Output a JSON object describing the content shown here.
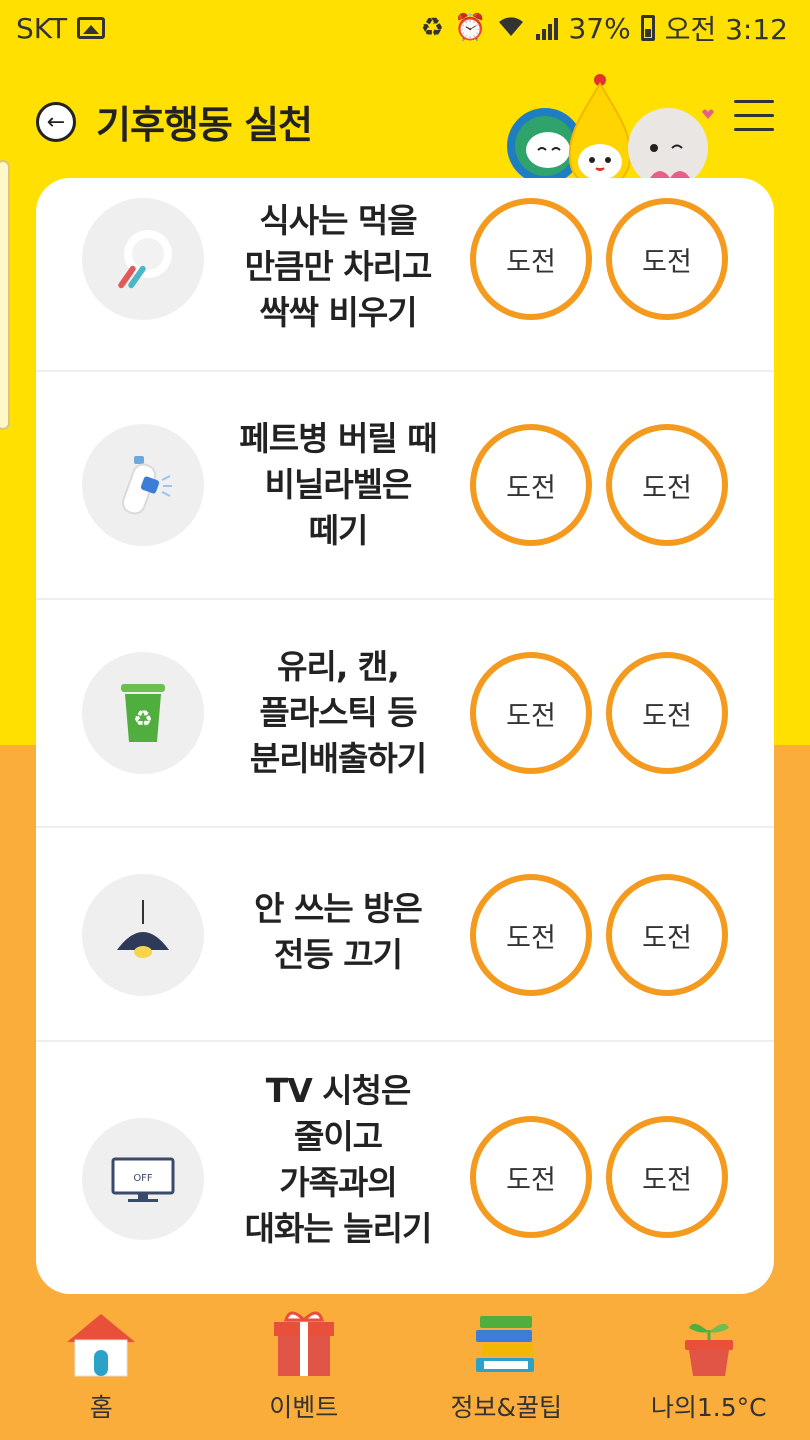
{
  "status_bar": {
    "carrier": "SKT",
    "battery": "37%",
    "time": "오전 3:12"
  },
  "header": {
    "title": "기후행동 실천"
  },
  "actions": [
    {
      "text": "식사는 먹을\n만큼만 차리고\n싹싹 비우기",
      "icon": "plate-icon",
      "btn1": "도전",
      "btn2": "도전"
    },
    {
      "text": "페트병 버릴 때\n비닐라벨은\n떼기",
      "icon": "pet-bottle-icon",
      "btn1": "도전",
      "btn2": "도전"
    },
    {
      "text": "유리, 캔,\n플라스틱 등\n분리배출하기",
      "icon": "recycle-bin-icon",
      "btn1": "도전",
      "btn2": "도전"
    },
    {
      "text": "안 쓰는 방은\n전등 끄기",
      "icon": "lamp-icon",
      "btn1": "도전",
      "btn2": "도전"
    },
    {
      "text": "TV 시청은\n줄이고\n가족과의\n대화는 늘리기",
      "icon": "tv-off-icon",
      "icon_text": "OFF",
      "btn1": "도전",
      "btn2": "도전"
    }
  ],
  "nav": [
    {
      "label": "홈",
      "icon": "home-icon"
    },
    {
      "label": "이벤트",
      "icon": "gift-icon"
    },
    {
      "label": "정보&꿀팁",
      "icon": "books-icon"
    },
    {
      "label": "나의1.5°C",
      "icon": "sprout-pot-icon"
    }
  ],
  "colors": {
    "header_yellow": "#FFE000",
    "bottom_orange": "#FBAD3B",
    "button_ring": "#F49A1E"
  }
}
